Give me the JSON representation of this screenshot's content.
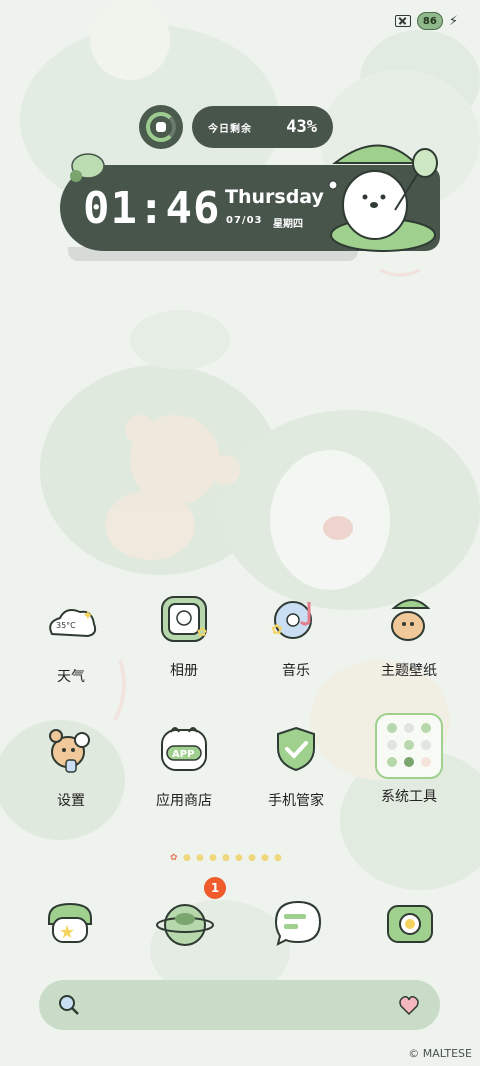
{
  "status_bar": {
    "battery_level": "86"
  },
  "widget": {
    "remaining_label": "今日剩余",
    "remaining_value": "43%",
    "time": "01:46",
    "day": "Thursday",
    "date": "07/03",
    "weekday": "星期四"
  },
  "apps": [
    {
      "label": "天气",
      "icon": "weather-icon",
      "temp": "35°C"
    },
    {
      "label": "相册",
      "icon": "gallery-icon"
    },
    {
      "label": "音乐",
      "icon": "music-icon"
    },
    {
      "label": "主题壁纸",
      "icon": "theme-icon"
    },
    {
      "label": "设置",
      "icon": "settings-icon"
    },
    {
      "label": "应用商店",
      "icon": "app-store-icon",
      "store_text": "APP"
    },
    {
      "label": "手机管家",
      "icon": "security-icon"
    },
    {
      "label": "系统工具",
      "icon": "tools-folder-icon"
    }
  ],
  "dock": {
    "badge_count": "1",
    "items": [
      "phone-icon",
      "browser-icon",
      "messages-icon",
      "camera-icon"
    ]
  },
  "page_indicator": {
    "count": 9,
    "active_index": 0
  },
  "copyright": "© MALTESE",
  "colors": {
    "dark_panel": "#48554b",
    "accent_green": "#9ccc8f",
    "badge": "#ef5b2b",
    "search_bar": "#c9dcc8"
  }
}
